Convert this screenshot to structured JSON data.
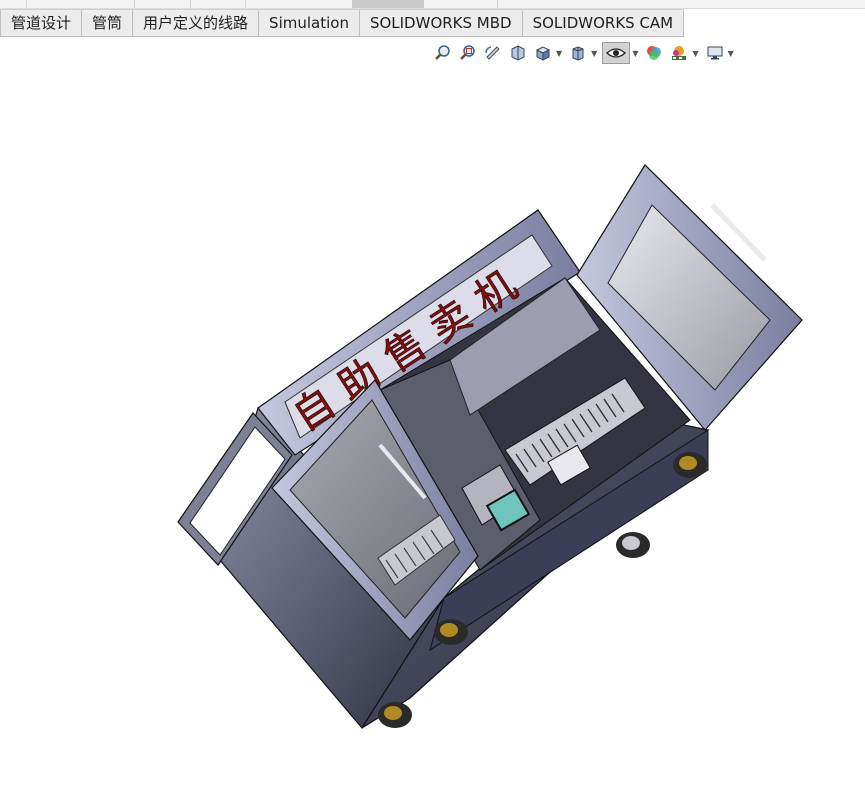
{
  "command_manager": {
    "tabs": [
      {
        "label": "管道设计"
      },
      {
        "label": "管筒"
      },
      {
        "label": "用户定义的线路"
      },
      {
        "label": "Simulation"
      },
      {
        "label": "SOLIDWORKS MBD"
      },
      {
        "label": "SOLIDWORKS CAM"
      }
    ]
  },
  "heads_up_toolbar": {
    "buttons": [
      {
        "icon": "zoom-to-fit-icon"
      },
      {
        "icon": "zoom-to-area-icon"
      },
      {
        "icon": "previous-view-icon"
      },
      {
        "icon": "section-view-icon"
      },
      {
        "icon": "view-orientation-icon"
      },
      {
        "icon": "display-style-icon"
      },
      {
        "icon": "hide-show-items-icon"
      },
      {
        "icon": "edit-appearance-icon"
      },
      {
        "icon": "apply-scene-icon"
      },
      {
        "icon": "view-settings-icon"
      }
    ]
  },
  "model": {
    "panel_text": "自助售卖机",
    "colors": {
      "body": "#4a4d68",
      "frame": "#9ea1c2",
      "glass": "#b7b7bf",
      "wheel": "#b08a22",
      "screen": "#5cb8b0"
    }
  }
}
